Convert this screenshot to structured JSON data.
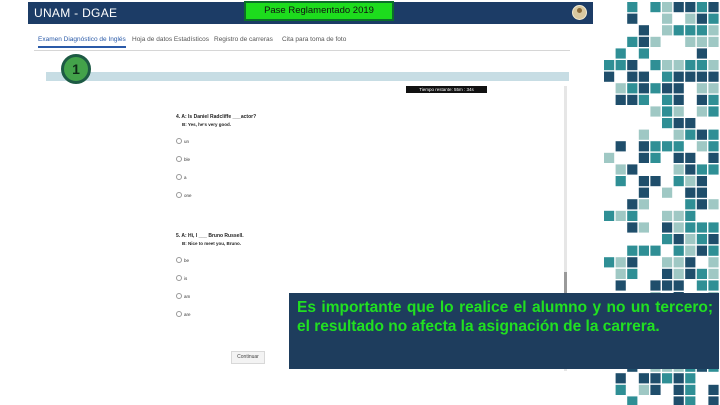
{
  "app": {
    "title": "UNAM - DGAE"
  },
  "banner": {
    "text": "Pase Reglamentado 2019"
  },
  "tabs": [
    {
      "label": "Examen Diagnóstico de Inglés",
      "active": true
    },
    {
      "label": "Hoja de datos Estadísticos",
      "active": false
    },
    {
      "label": "Registro de carreras",
      "active": false
    },
    {
      "label": "Cita para toma de foto",
      "active": false
    }
  ],
  "step": {
    "number": "1"
  },
  "timer": {
    "text": "Tiempo restante: 55m : 34s"
  },
  "questions": [
    {
      "prompt": "4. A: Is Daniel Radcliffe ___actor?",
      "sub": "B: Yes, he's very good.",
      "options": [
        "un",
        "ble",
        "a",
        "one"
      ]
    },
    {
      "prompt": "5. A: Hi, I ___ Bruno Russell.",
      "sub": "B: Nice to meet you, Bruno.",
      "options": [
        "be",
        "is",
        "am",
        "are"
      ]
    }
  ],
  "continue_label": "Continuar",
  "note": {
    "text": "Es importante que lo realice el alumno y no un tercero; el resultado no afecta la asignación de la carrera."
  },
  "colors": {
    "appbar": "#1c3c66",
    "banner": "#1ddc1d",
    "note_bg": "#1e3d5d",
    "note_text": "#21e021",
    "step_circle": "#43a24a",
    "mosaic_dark": "#1f4e6b",
    "mosaic_teal": "#2f8f95",
    "mosaic_light": "#9fc8c4"
  }
}
